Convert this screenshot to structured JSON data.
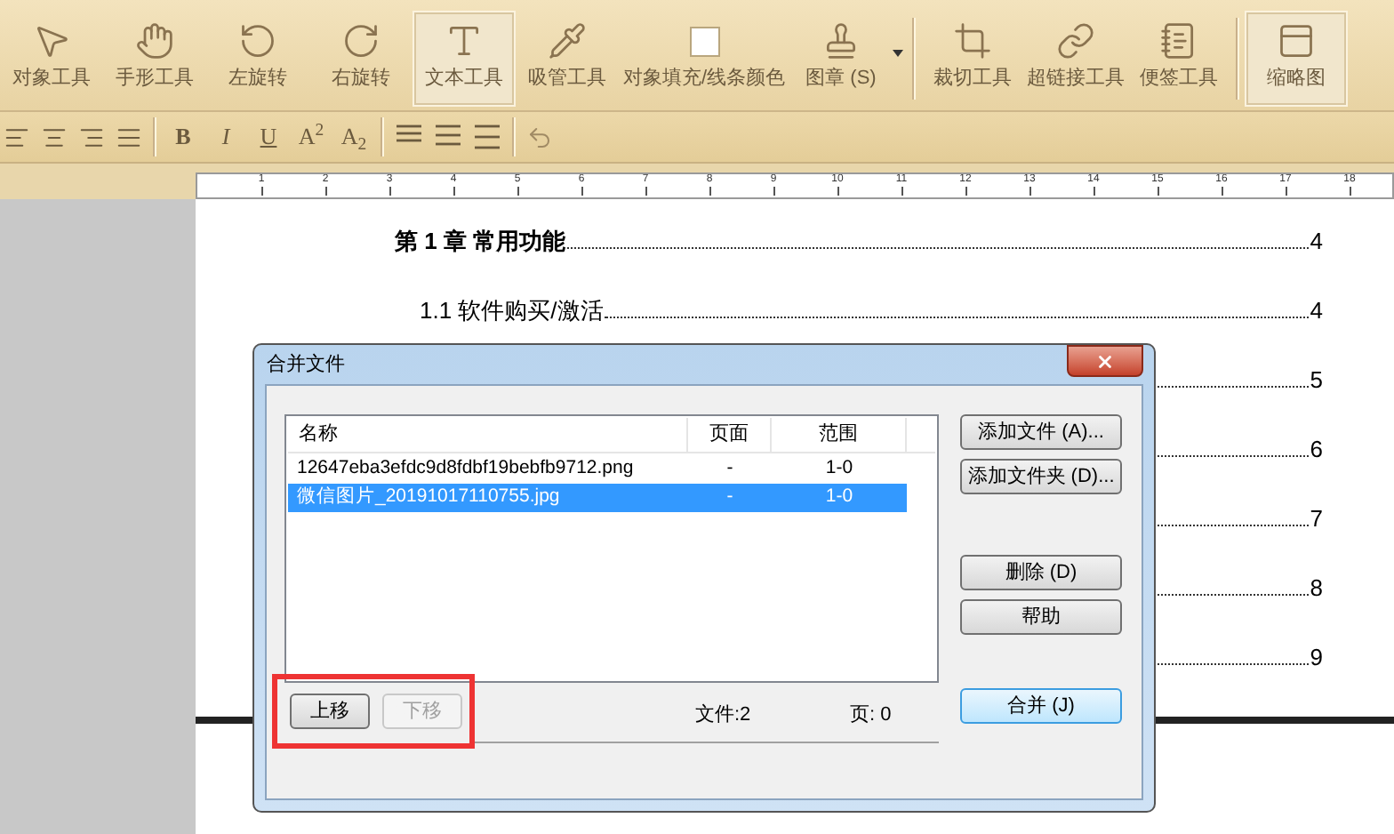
{
  "toolbar": {
    "tools": [
      {
        "label": "对象工具",
        "selected": false
      },
      {
        "label": "手形工具",
        "selected": false
      },
      {
        "label": "左旋转",
        "selected": false
      },
      {
        "label": "右旋转",
        "selected": false
      },
      {
        "label": "文本工具",
        "selected": true
      },
      {
        "label": "吸管工具",
        "selected": false
      },
      {
        "label": "对象填充/线条颜色",
        "selected": false
      },
      {
        "label": "图章 (S)",
        "selected": false
      },
      {
        "label": "裁切工具",
        "selected": false
      },
      {
        "label": "超链接工具",
        "selected": false
      },
      {
        "label": "便签工具",
        "selected": false
      },
      {
        "label": "缩略图",
        "selected": true
      }
    ]
  },
  "format_bar": {
    "groups": [
      [
        "B",
        "I",
        "U",
        "A$^{2}$",
        "A$_{2}$"
      ]
    ]
  },
  "ruler": {
    "numbers": [
      "1",
      "2",
      "3",
      "4",
      "5",
      "6",
      "7",
      "8",
      "9",
      "10",
      "11",
      "12",
      "13",
      "14",
      "15",
      "16",
      "17",
      "18"
    ]
  },
  "document": {
    "toc": [
      {
        "title": "第 1 章  常用功能",
        "page": "4",
        "children": [
          {
            "title": "1.1 软件购买/激活",
            "page": "4"
          },
          {
            "page": "5"
          },
          {
            "page": "6"
          },
          {
            "page": "7"
          },
          {
            "page": "8"
          },
          {
            "page": "9"
          }
        ]
      }
    ]
  },
  "dialog": {
    "title": "合并文件",
    "columns": [
      "名称",
      "页面",
      "范围"
    ],
    "rows": [
      {
        "name": "12647eba3efdc9d8fdbf19bebfb9712.png",
        "pages": "-",
        "range": "1-0",
        "selected": false
      },
      {
        "name": "微信图片_20191017110755.jpg",
        "pages": "-",
        "range": "1-0",
        "selected": true
      }
    ],
    "side_buttons": [
      "添加文件 (A)...",
      "添加文件夹 (D)...",
      "删除 (D)",
      "帮助"
    ],
    "move_buttons": [
      {
        "label": "上移",
        "disabled": false
      },
      {
        "label": "下移",
        "disabled": true
      }
    ],
    "highlight": true,
    "file_count": "文件:2",
    "page_count": "页: 0",
    "merge_button": {
      "label": "合并 (J)",
      "default": true
    }
  }
}
